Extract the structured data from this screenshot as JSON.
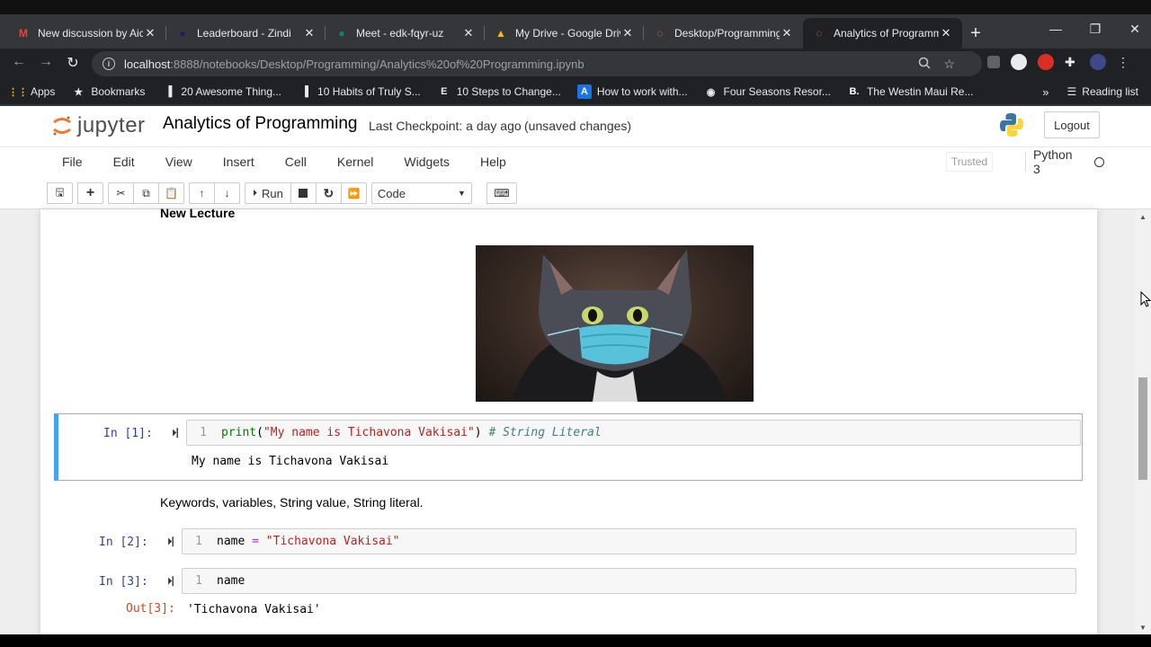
{
  "browser": {
    "tabs": [
      {
        "title": "New discussion by Aic",
        "icon": "gmail-icon",
        "color": "#ea4335"
      },
      {
        "title": "Leaderboard - Zindi",
        "icon": "zindi-icon",
        "color": "#1a1a6e"
      },
      {
        "title": "Meet - edk-fqyr-uz",
        "icon": "meet-icon",
        "color": "#00897b"
      },
      {
        "title": "My Drive - Google Driv",
        "icon": "drive-icon",
        "color": "#fbbc04"
      },
      {
        "title": "Desktop/Programming/",
        "icon": "jupyter-icon",
        "color": "#f37626"
      },
      {
        "title": "Analytics of Programmi",
        "icon": "jupyter-icon",
        "color": "#f37626"
      }
    ],
    "tab_close": "✕",
    "new_tab": "+",
    "url_host": "localhost",
    "url_path": ":8888/notebooks/Desktop/Programming/Analytics%20of%20Programming.ipynb",
    "bookmarks": [
      {
        "label": "Apps",
        "icon": "apps-grid-icon"
      },
      {
        "label": "Bookmarks",
        "icon": "star-icon"
      },
      {
        "label": "20 Awesome Thing...",
        "icon": "medium-icon"
      },
      {
        "label": "10 Habits of Truly S...",
        "icon": "medium-icon"
      },
      {
        "label": "10 Steps to Change...",
        "icon": "e-icon"
      },
      {
        "label": "How to work with...",
        "icon": "a-icon"
      },
      {
        "label": "Four Seasons Resor...",
        "icon": "globe-icon"
      },
      {
        "label": "The Westin Maui Re...",
        "icon": "b-icon"
      }
    ],
    "reading_list": "Reading list"
  },
  "jupyter": {
    "logo_text": "jupyter",
    "notebook_title": "Analytics of Programming",
    "checkpoint": "Last Checkpoint: a day ago",
    "unsaved": "(unsaved changes)",
    "logout": "Logout",
    "menu": [
      "File",
      "Edit",
      "View",
      "Insert",
      "Cell",
      "Kernel",
      "Widgets",
      "Help"
    ],
    "trusted": "Trusted",
    "kernel": "Python 3",
    "run_label": "Run",
    "cell_type": "Code"
  },
  "notebook": {
    "heading": "New Lecture",
    "image_alt": "cat-wearing-mask-image",
    "cell1": {
      "prompt": "In [1]:",
      "line": "1",
      "output": "My name is Tichavona Vakisai"
    },
    "markdown2": "Keywords, variables, String value, String literal.",
    "cell2": {
      "prompt": "In [2]:",
      "line": "1"
    },
    "cell3": {
      "prompt": "In [3]:",
      "line": "1",
      "code": "name",
      "out_prompt": "Out[3]:",
      "output": "'Tichavona Vakisai'"
    }
  }
}
